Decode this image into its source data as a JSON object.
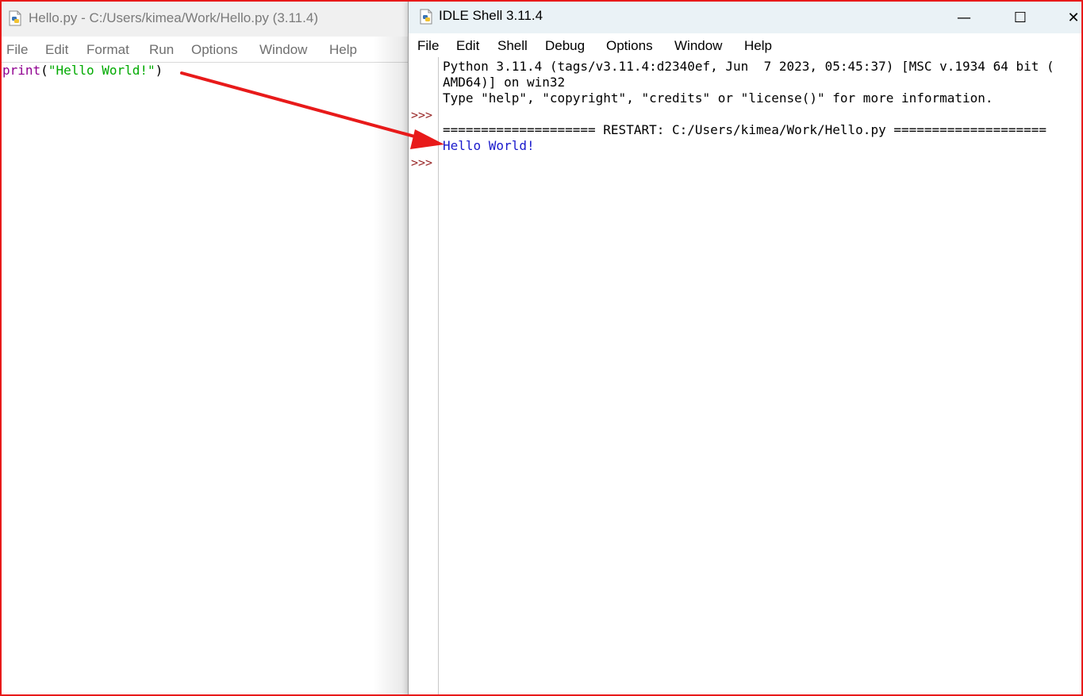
{
  "editor": {
    "title": "Hello.py - C:/Users/kimea/Work/Hello.py (3.11.4)",
    "menu": [
      "File",
      "Edit",
      "Format",
      "Run",
      "Options",
      "Window",
      "Help"
    ],
    "code": {
      "func": "print",
      "open": "(",
      "string": "\"Hello World!\"",
      "close": ")"
    }
  },
  "shell": {
    "title": "IDLE Shell 3.11.4",
    "menu": [
      "File",
      "Edit",
      "Shell",
      "Debug",
      "Options",
      "Window",
      "Help"
    ],
    "controls": {
      "minimize": "—",
      "maximize": "☐",
      "close": "✕"
    },
    "banner_line1": "Python 3.11.4 (tags/v3.11.4:d2340ef, Jun  7 2023, 05:45:37) [MSC v.1934 64 bit (",
    "banner_line2": "AMD64)] on win32",
    "banner_line3": "Type \"help\", \"copyright\", \"credits\" or \"license()\" for more information.",
    "restart_line": "==================== RESTART: C:/Users/kimea/Work/Hello.py ====================",
    "output": "Hello World!",
    "prompt": ">>>"
  },
  "annotation": {
    "color": "#e81a1a",
    "icon": "red-arrow"
  },
  "colors": {
    "builtin": "#900090",
    "string": "#00aa00",
    "output": "#1a1acc",
    "prompt": "#9a2a2a",
    "border": "#e81a1a"
  }
}
